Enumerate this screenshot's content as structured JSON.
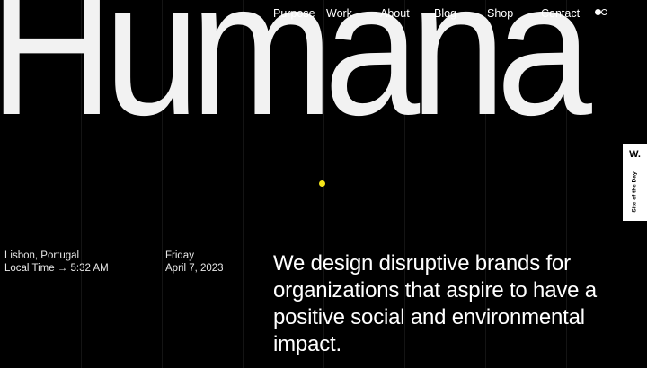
{
  "nav": {
    "items": [
      "Purpose",
      "Work",
      "About",
      "Blog",
      "Shop",
      "Contact"
    ]
  },
  "theme_toggle": {
    "icon": "theme-toggle-icon"
  },
  "hero": {
    "wordmark": "Humana"
  },
  "badge": {
    "logo": "W.",
    "label": "Site of the Day"
  },
  "location": {
    "city": "Lisbon, Portugal",
    "local_time": "Local Time → 5:32 AM"
  },
  "date": {
    "weekday": "Friday",
    "full_date": "April 7, 2023"
  },
  "tagline": "We design disruptive brands for organizations that aspire to have a positive social and environmental impact.",
  "colors": {
    "background": "#000000",
    "text": "#ffffff",
    "accent_dot": "#f5e51a"
  }
}
